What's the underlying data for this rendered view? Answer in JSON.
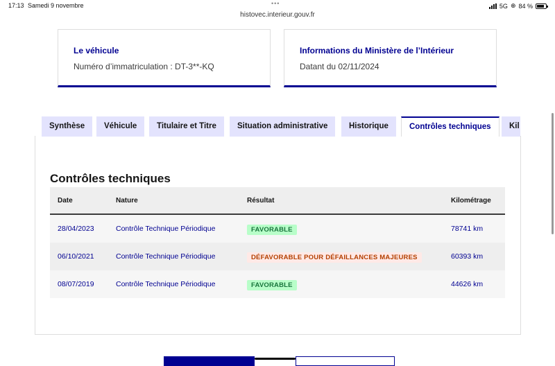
{
  "status_bar": {
    "time": "17:13",
    "date": "Samedi 9 novembre",
    "dots": "•••",
    "url": "histovec.interieur.gouv.fr",
    "network": "5G",
    "battery": "84 %"
  },
  "cards": [
    {
      "title": "Le véhicule",
      "text": "Numéro d’immatriculation : DT-3**-KQ"
    },
    {
      "title": "Informations du Ministère de l’Intérieur",
      "text": "Datant du 02/11/2024"
    }
  ],
  "tabs": [
    {
      "label": "Synthèse",
      "active": false
    },
    {
      "label": "Véhicule",
      "active": false
    },
    {
      "label": "Titulaire et Titre",
      "active": false
    },
    {
      "label": "Situation administrative",
      "active": false
    },
    {
      "label": "Historique",
      "active": false
    },
    {
      "label": "Contrôles techniques",
      "active": true
    },
    {
      "label": "Kil",
      "active": false
    }
  ],
  "section_title": "Contrôles techniques",
  "table": {
    "headers": {
      "date": "Date",
      "nature": "Nature",
      "result": "Résultat",
      "mileage": "Kilométrage"
    },
    "rows": [
      {
        "date": "28/04/2023",
        "nature": "Contrôle Technique Périodique",
        "result": "FAVORABLE",
        "status": "ok",
        "mileage": "78741 km"
      },
      {
        "date": "06/10/2021",
        "nature": "Contrôle Technique Périodique",
        "result": "DÉFAVORABLE POUR DÉFAILLANCES MAJEURES",
        "status": "ko",
        "mileage": "60393 km"
      },
      {
        "date": "08/07/2019",
        "nature": "Contrôle Technique Périodique",
        "result": "FAVORABLE",
        "status": "ok",
        "mileage": "44626 km"
      }
    ]
  },
  "colors": {
    "primary": "#000091",
    "tab_bg": "#e3e3fd",
    "success_bg": "#b8fec9",
    "success_text": "#18753c",
    "error_bg": "#ffe9e6",
    "error_text": "#b34000"
  }
}
